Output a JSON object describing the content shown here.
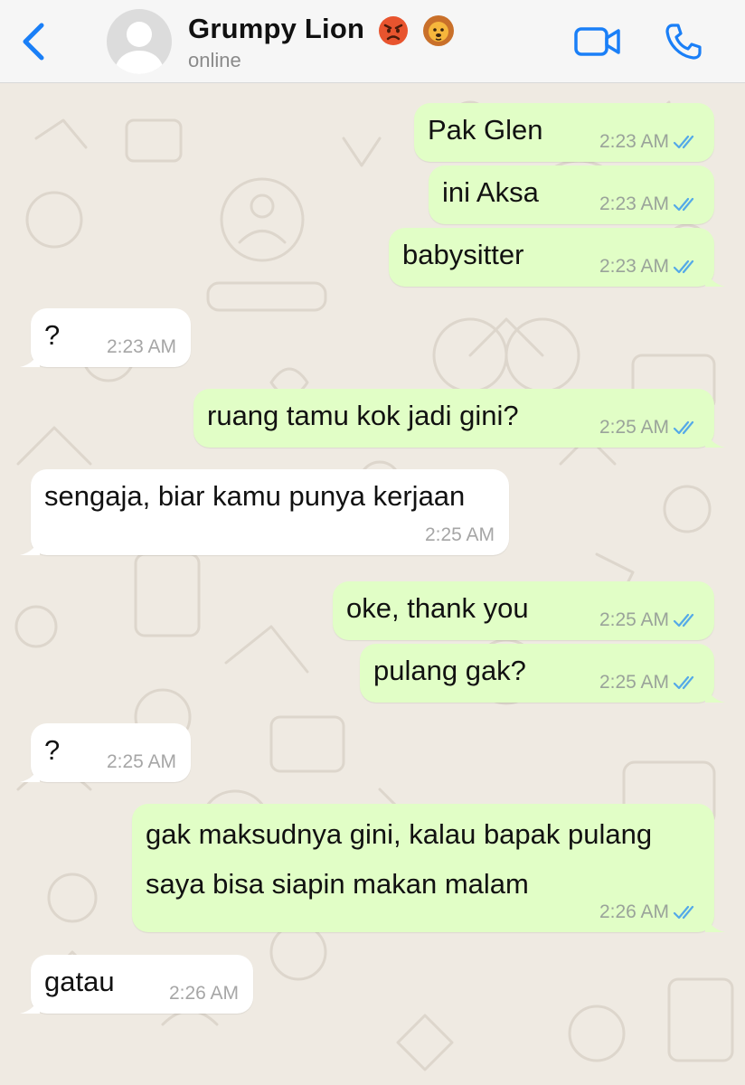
{
  "header": {
    "name": "Grumpy Lion",
    "status": "online",
    "emojis": [
      "angry-face-emoji",
      "lion-face-emoji"
    ]
  },
  "colors": {
    "accent": "#1a7ff7",
    "outgoing_bubble": "#e1fec6",
    "incoming_bubble": "#ffffff",
    "read_ticks": "#54a9e8",
    "chat_background": "#efeae2"
  },
  "messages": [
    {
      "dir": "out",
      "text": "Pak Glen",
      "time": "2:23 AM"
    },
    {
      "dir": "out",
      "text": "ini Aksa",
      "time": "2:23 AM"
    },
    {
      "dir": "out",
      "text": "babysitter",
      "time": "2:23 AM"
    },
    {
      "dir": "in",
      "text": "?",
      "time": "2:23 AM"
    },
    {
      "dir": "out",
      "text": "ruang tamu kok jadi gini?",
      "time": "2:25 AM"
    },
    {
      "dir": "in",
      "text": "sengaja, biar kamu punya kerjaan",
      "time": "2:25 AM"
    },
    {
      "dir": "out",
      "text": "oke, thank you",
      "time": "2:25 AM"
    },
    {
      "dir": "out",
      "text": "pulang gak?",
      "time": "2:25 AM"
    },
    {
      "dir": "in",
      "text": "?",
      "time": "2:25 AM"
    },
    {
      "dir": "out",
      "text": "gak maksudnya gini, kalau bapak pulang\nsaya bisa siapin makan malam",
      "time": "2:26 AM"
    },
    {
      "dir": "in",
      "text": "gatau",
      "time": "2:26 AM"
    }
  ]
}
